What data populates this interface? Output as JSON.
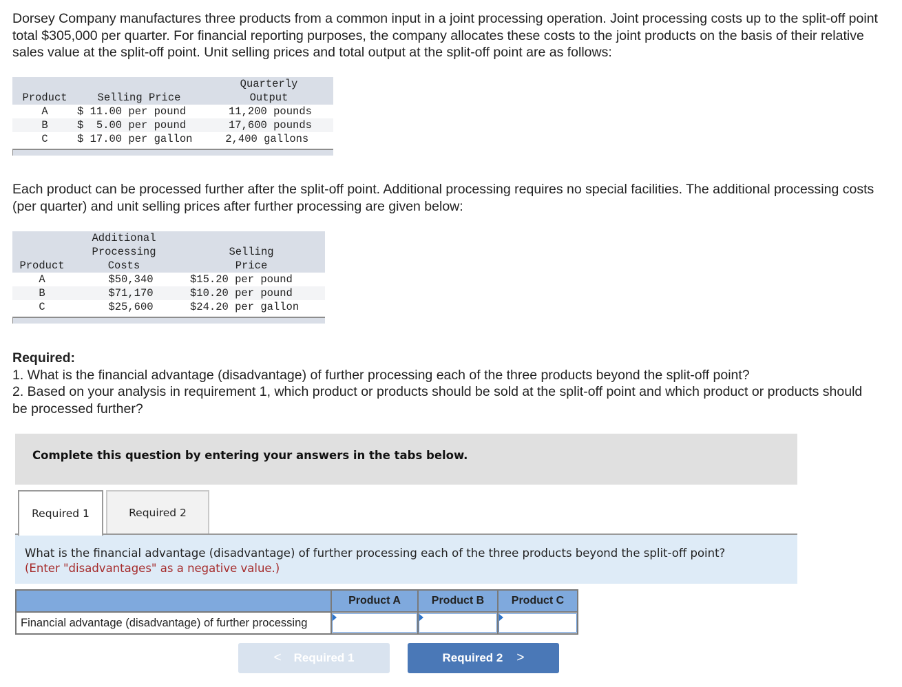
{
  "intro_text": "Dorsey Company manufactures three products from a common input in a joint processing operation. Joint processing costs up to the split-off point total $305,000 per quarter. For financial reporting purposes, the company allocates these costs to the joint products on the basis of their relative sales value at the split-off point. Unit selling prices and total output at the split-off point are as follows:",
  "table1": {
    "headers": {
      "product": "Product",
      "selling_price": "Selling Price",
      "output_line1": "Quarterly",
      "output_line2": "Output"
    },
    "rows": [
      {
        "product": "A",
        "selling_price": "$ 11.00 per pound",
        "output": "11,200 pounds"
      },
      {
        "product": "B",
        "selling_price": "$  5.00 per pound",
        "output": "17,600 pounds"
      },
      {
        "product": "C",
        "selling_price": "$ 17.00 per gallon",
        "output": " 2,400 gallons"
      }
    ]
  },
  "para2_text": "Each product can be processed further after the split-off point. Additional processing requires no special facilities. The additional processing costs (per quarter) and unit selling prices after further processing are given below:",
  "table2": {
    "headers": {
      "product": "Product",
      "costs_line1": "Additional",
      "costs_line2": "Processing",
      "costs_line3": "Costs",
      "price_line1": "Selling",
      "price_line2": "Price"
    },
    "rows": [
      {
        "product": "A",
        "costs": "$50,340",
        "price": "$15.20 per pound"
      },
      {
        "product": "B",
        "costs": "$71,170",
        "price": "$10.20 per pound"
      },
      {
        "product": "C",
        "costs": "$25,600",
        "price": "$24.20 per gallon"
      }
    ]
  },
  "required": {
    "title": "Required:",
    "items": [
      "1. What is the financial advantage (disadvantage) of further processing each of the three products beyond the split-off point?",
      "2. Based on your analysis in requirement 1, which product or products should be sold at the split-off point and which product or products should be processed further?"
    ]
  },
  "instruction": "Complete this question by entering your answers in the tabs below.",
  "tabs": [
    {
      "label": "Required 1",
      "active": true
    },
    {
      "label": "Required 2",
      "active": false
    }
  ],
  "question_panel": {
    "question": "What is the financial advantage (disadvantage) of further processing each of the three products beyond the split-off point?",
    "hint": "(Enter \"disadvantages\" as a negative value.)"
  },
  "answer_table": {
    "columns": [
      "Product A",
      "Product B",
      "Product C"
    ],
    "row_label": "Financial advantage (disadvantage) of further processing",
    "values": [
      "",
      "",
      ""
    ]
  },
  "nav": {
    "prev_label": "Required 1",
    "next_label": "Required 2",
    "prev_icon": "chevron-left-icon",
    "next_icon": "chevron-right-icon"
  },
  "colors": {
    "table_header_bg": "#d9dee7",
    "instruction_bg": "#e0e0e0",
    "question_bg": "#deebf7",
    "hint_text": "#a52a2a",
    "answer_header_bg": "#7fa9dd",
    "next_button_bg": "#4a78b7",
    "prev_button_bg": "#d9e3ef"
  }
}
